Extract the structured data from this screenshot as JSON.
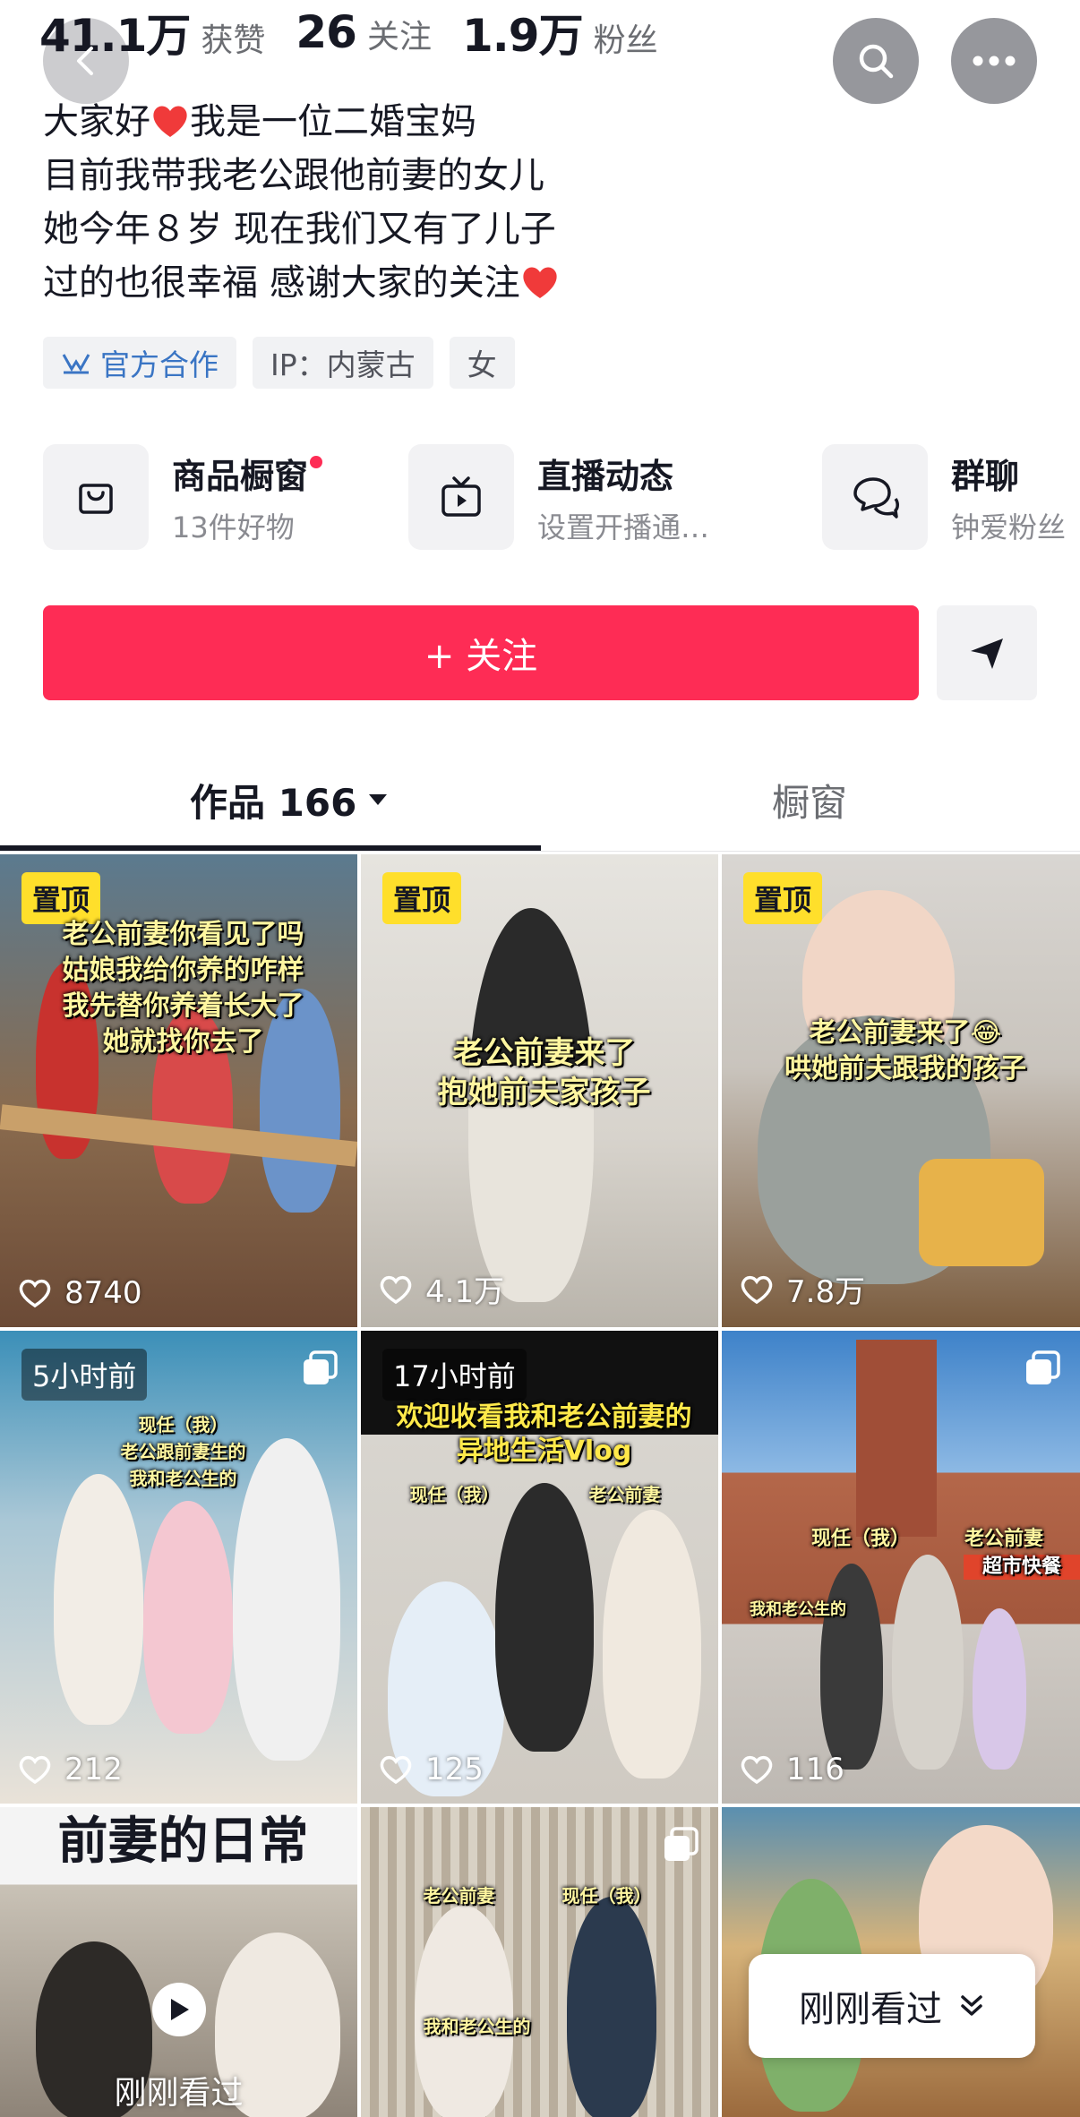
{
  "stats": [
    {
      "value": "41.1万",
      "label": "获赞"
    },
    {
      "value": "26",
      "label": "关注"
    },
    {
      "value": "1.9万",
      "label": "粉丝"
    }
  ],
  "bio": [
    {
      "text": "大家好",
      "after_heart": "我是一位二婚宝妈"
    },
    {
      "text": "目前我带我老公跟他前妻的女儿"
    },
    {
      "text": "她今年８岁 现在我们又有了儿子"
    },
    {
      "text": "过的也很幸福 感谢大家的关注"
    }
  ],
  "tags": {
    "official": "官方合作",
    "ip": "IP：内蒙古",
    "gender": "女"
  },
  "features": [
    {
      "title": "商品橱窗",
      "subtitle": "13件好物",
      "icon": "shopping-bag-icon"
    },
    {
      "title": "直播动态",
      "subtitle": "设置开播通…",
      "icon": "tv-icon"
    },
    {
      "title": "群聊",
      "subtitle": "钟爱粉丝",
      "icon": "chat-bubbles-icon"
    }
  ],
  "follow_label": "+ 关注",
  "tabs": {
    "works": "作品 166",
    "shop": "橱窗"
  },
  "videos": [
    {
      "badge": "置顶",
      "badge_type": "pin",
      "caption": [
        "老公前妻你看见了吗",
        "姑娘我给你养的咋样",
        "我先替你养着长大了",
        "她就找你去了"
      ],
      "likes": "8740"
    },
    {
      "badge": "置顶",
      "badge_type": "pin",
      "caption": [
        "老公前妻来了",
        "抱她前夫家孩子"
      ],
      "likes": "4.1万"
    },
    {
      "badge": "置顶",
      "badge_type": "pin",
      "caption": [
        "老公前妻来了😂",
        "哄她前夫跟我的孩子"
      ],
      "likes": "7.8万"
    },
    {
      "badge": "5小时前",
      "badge_type": "time",
      "caption": [
        "现任（我）",
        "老公跟前妻生的",
        "我和老公生的"
      ],
      "likes": "212"
    },
    {
      "badge": "17小时前",
      "badge_type": "time",
      "caption": [
        "欢迎收看我和老公前妻的",
        "异地生活Vlog",
        "现任（我）",
        "老公前妻"
      ],
      "likes": "125"
    },
    {
      "badge": "",
      "badge_type": "none",
      "caption": [
        "现任（我）",
        "老公前妻",
        "我和老公生的",
        "超市快餐"
      ],
      "likes": "116"
    },
    {
      "badge": "",
      "badge_type": "none",
      "caption": [
        "前妻的日常"
      ],
      "likes": "",
      "recent": "刚刚看过"
    },
    {
      "badge": "",
      "badge_type": "none",
      "caption": [
        "老公前妻",
        "现任（我）",
        "我和老公生的"
      ],
      "likes": ""
    },
    {
      "badge": "",
      "badge_type": "none",
      "caption": [],
      "likes": ""
    }
  ],
  "recently_viewed": "刚刚看过",
  "colors": {
    "accent": "#fe2c55",
    "pin_badge": "#ffdf2b",
    "official_tag": "#3a75c4"
  }
}
